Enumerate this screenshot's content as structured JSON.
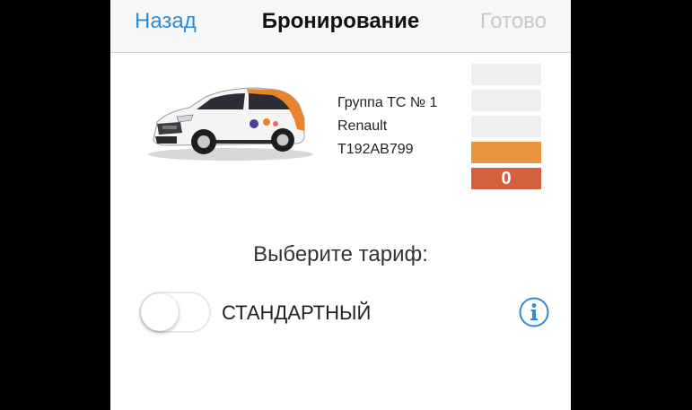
{
  "navbar": {
    "back_label": "Назад",
    "title": "Бронирование",
    "done_label": "Готово"
  },
  "car": {
    "group": "Группа ТС № 1",
    "brand": "Renault",
    "plate": "Т192АВ799"
  },
  "status_indicators": {
    "count_value": "0"
  },
  "tariff": {
    "heading": "Выберите тариф:",
    "option_label": "СТАНДАРТНЫЙ",
    "option_enabled": false
  },
  "colors": {
    "accent_blue": "#2f8bd8",
    "car_orange": "#e8842c",
    "status_orange": "#e99540",
    "status_red": "#d4603f",
    "status_gray": "#efefef"
  }
}
